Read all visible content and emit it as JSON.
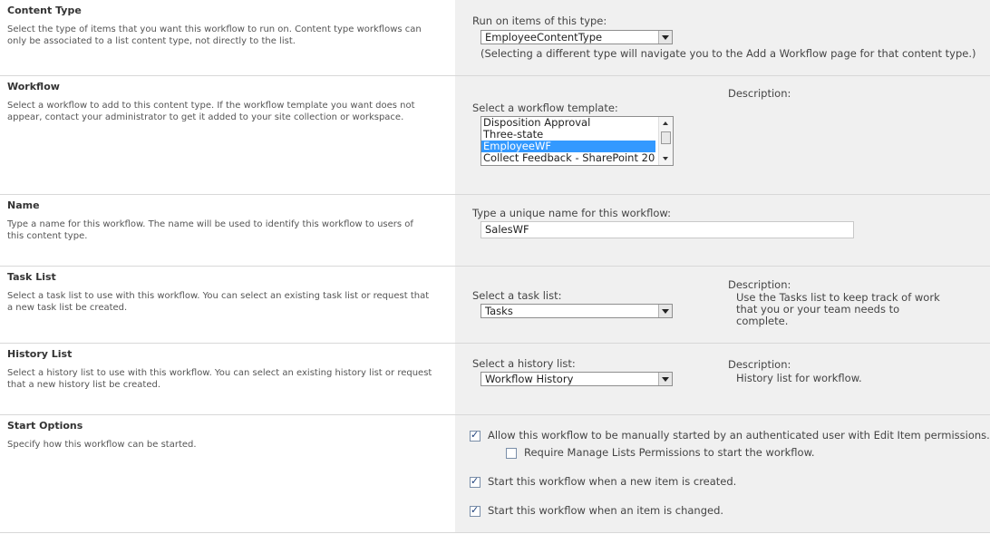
{
  "content_type": {
    "title": "Content Type",
    "description": "Select the type of items that you want this workflow to run on. Content type workflows can only be associated to a list content type, not directly to the list.",
    "run_on_label": "Run on items of this type:",
    "selected": "EmployeeContentType",
    "note": "(Selecting a different type will navigate you to the Add a Workflow page for that content type.)"
  },
  "workflow": {
    "title": "Workflow",
    "description": "Select a workflow to add to this content type. If the workflow template you want does not appear, contact your administrator to get it added to your site collection or workspace.",
    "template_label": "Select a workflow template:",
    "description_label": "Description:",
    "templates": [
      "Disposition Approval",
      "Three-state",
      "EmployeeWF",
      "Collect Feedback - SharePoint 20"
    ],
    "selected_template": "EmployeeWF"
  },
  "name": {
    "title": "Name",
    "description": "Type a name for this workflow. The name will be used to identify this workflow to users of this content type.",
    "input_label": "Type a unique name for this workflow:",
    "value": "SalesWF"
  },
  "task_list": {
    "title": "Task List",
    "description": "Select a task list to use with this workflow. You can select an existing task list or request that a new task list be created.",
    "select_label": "Select a task list:",
    "selected": "Tasks",
    "description_label": "Description:",
    "description_text": "Use the Tasks list to keep track of work that you or your team needs to complete."
  },
  "history_list": {
    "title": "History List",
    "description": "Select a history list to use with this workflow. You can select an existing history list or request that a new history list be created.",
    "select_label": "Select a history list:",
    "selected": "Workflow History",
    "description_label": "Description:",
    "description_text": "History list for workflow."
  },
  "start_options": {
    "title": "Start Options",
    "description": "Specify how this workflow can be started.",
    "manual_label": "Allow this workflow to be manually started by an authenticated user with Edit Item permissions.",
    "manual_checked": true,
    "require_manage_label": "Require Manage Lists Permissions to start the workflow.",
    "require_manage_checked": false,
    "on_create_label": "Start this workflow when a new item is created.",
    "on_create_checked": true,
    "on_change_label": "Start this workflow when an item is changed.",
    "on_change_checked": true
  }
}
